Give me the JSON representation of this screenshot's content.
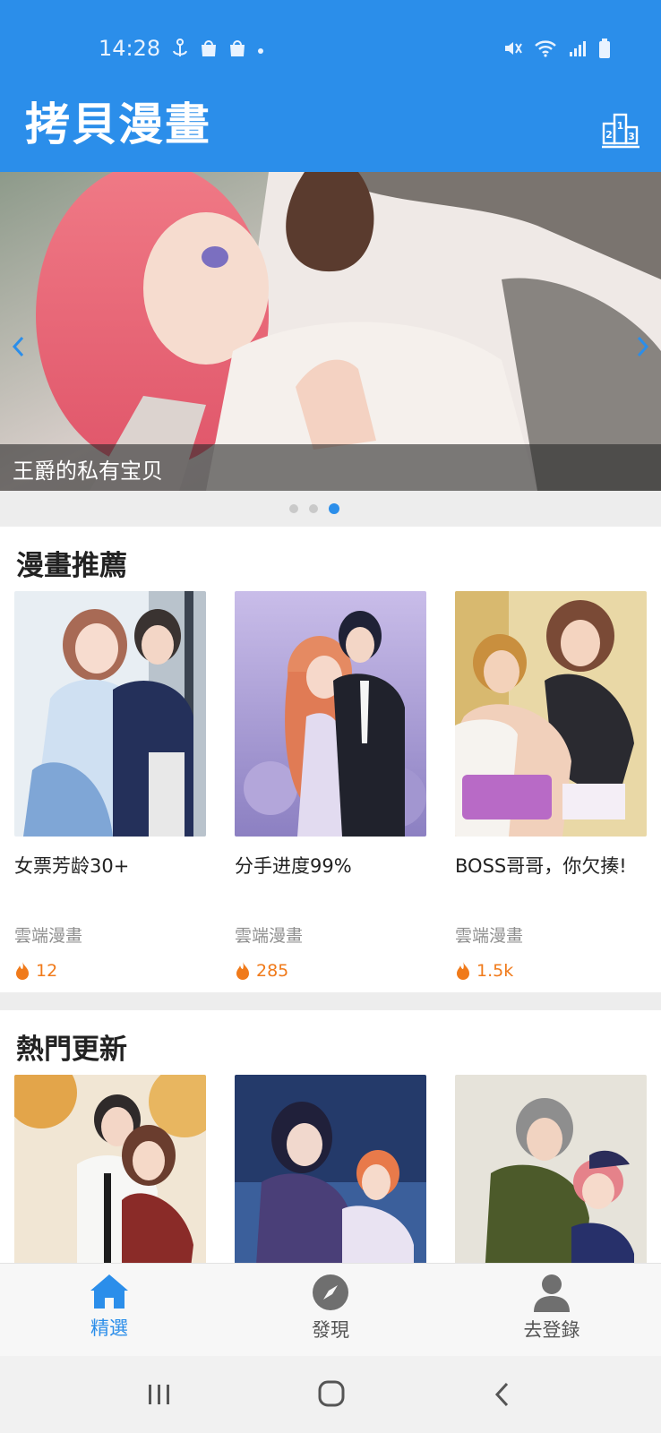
{
  "status": {
    "time": "14:28"
  },
  "header": {
    "app_title": "拷貝漫畫",
    "rank_icon": "ranking-podium-icon"
  },
  "banner": {
    "caption": "王爵的私有宝贝",
    "slides": 3,
    "active_slide": 3
  },
  "recommend": {
    "title": "漫畫推薦",
    "items": [
      {
        "title": "女票芳龄30+",
        "source": "雲端漫畫",
        "hot": "12"
      },
      {
        "title": "分手进度99%",
        "source": "雲端漫畫",
        "hot": "285"
      },
      {
        "title": "BOSS哥哥，你欠揍!",
        "source": "雲端漫畫",
        "hot": "1.5k"
      }
    ]
  },
  "hot_updates": {
    "title": "熱門更新"
  },
  "tabs": [
    {
      "label": "精選",
      "icon": "home-icon",
      "active": true
    },
    {
      "label": "發現",
      "icon": "compass-icon",
      "active": false
    },
    {
      "label": "去登錄",
      "icon": "user-icon",
      "active": false
    }
  ],
  "colors": {
    "primary": "#2b8eea",
    "hot": "#f07a1a"
  }
}
